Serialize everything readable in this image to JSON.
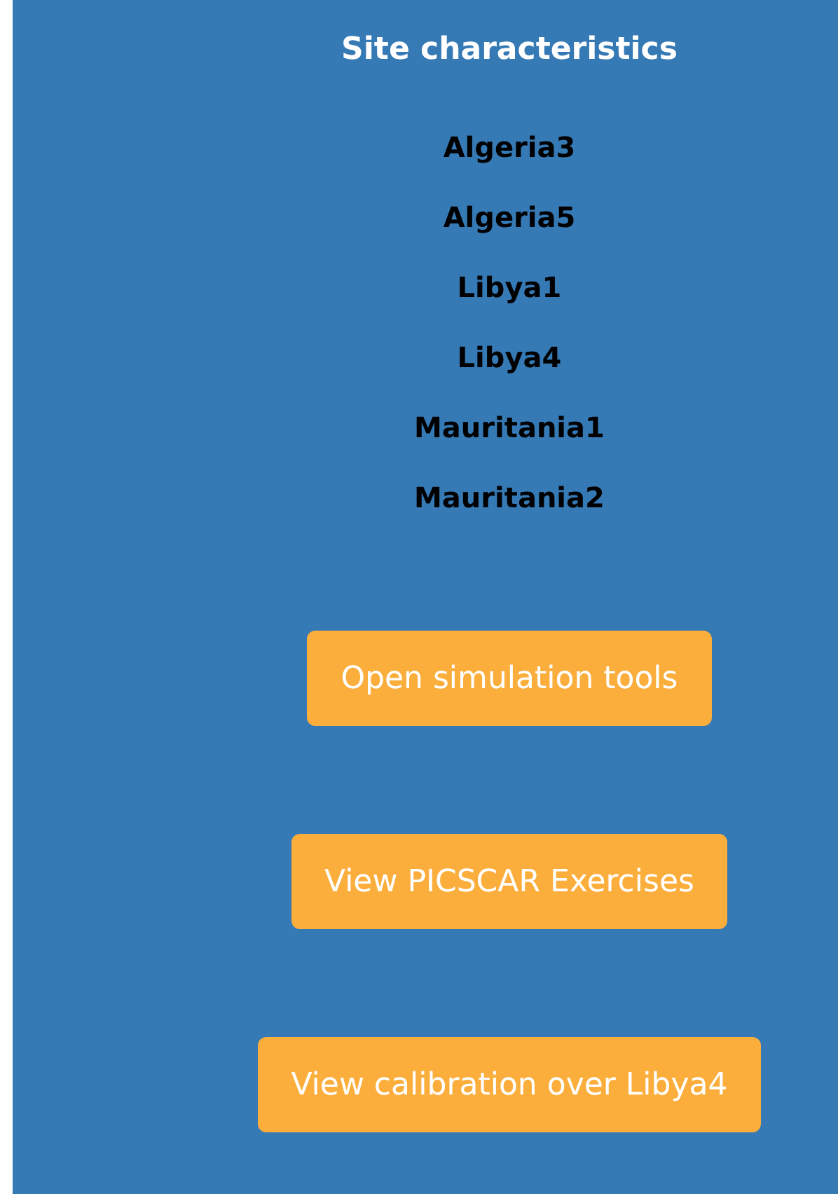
{
  "title": "Site characteristics",
  "sites": [
    "Algeria3",
    "Algeria5",
    "Libya1",
    "Libya4",
    "Mauritania1",
    "Mauritania2"
  ],
  "buttons": [
    "Open simulation tools",
    "View PICSCAR Exercises",
    "View calibration over Libya4"
  ]
}
